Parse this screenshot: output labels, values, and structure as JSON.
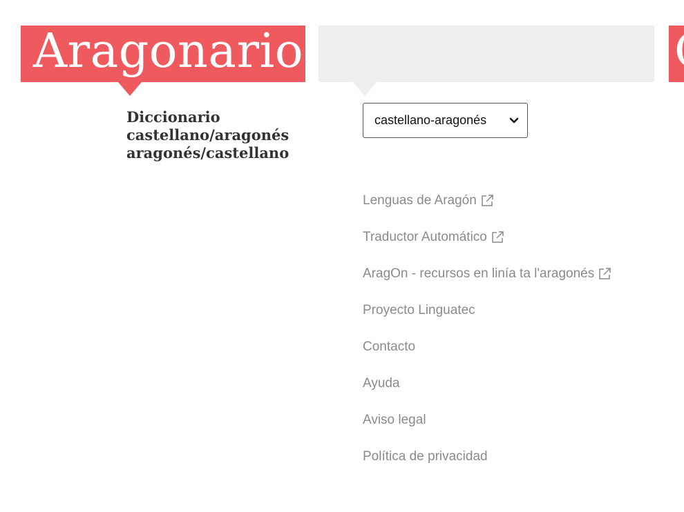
{
  "header": {
    "logo_text": "Aragonario",
    "right_banner_letter": "C"
  },
  "subtitle": {
    "line1": "Diccionario",
    "line2": "castellano/aragonés",
    "line3": "aragonés/castellano"
  },
  "language_select": {
    "selected": "castellano-aragonés",
    "icon": "chevron-down-icon"
  },
  "links": [
    {
      "label": "Lenguas de Aragón",
      "external": true,
      "icon": "external-link-icon"
    },
    {
      "label": "Traductor Automático",
      "external": true,
      "icon": "external-link-icon"
    },
    {
      "label": "AragOn - recursos en linía ta l'aragonés",
      "external": true,
      "icon": "external-link-icon"
    },
    {
      "label": "Proyecto Linguatec",
      "external": false
    },
    {
      "label": "Contacto",
      "external": false
    },
    {
      "label": "Ayuda",
      "external": false
    },
    {
      "label": "Aviso legal",
      "external": false
    },
    {
      "label": "Política de privacidad",
      "external": false
    }
  ],
  "colors": {
    "brand_red": "#ef5a5f",
    "banner_grey": "#eeeeee",
    "link_grey": "#8a8a8a",
    "subtitle_text": "#333333"
  }
}
